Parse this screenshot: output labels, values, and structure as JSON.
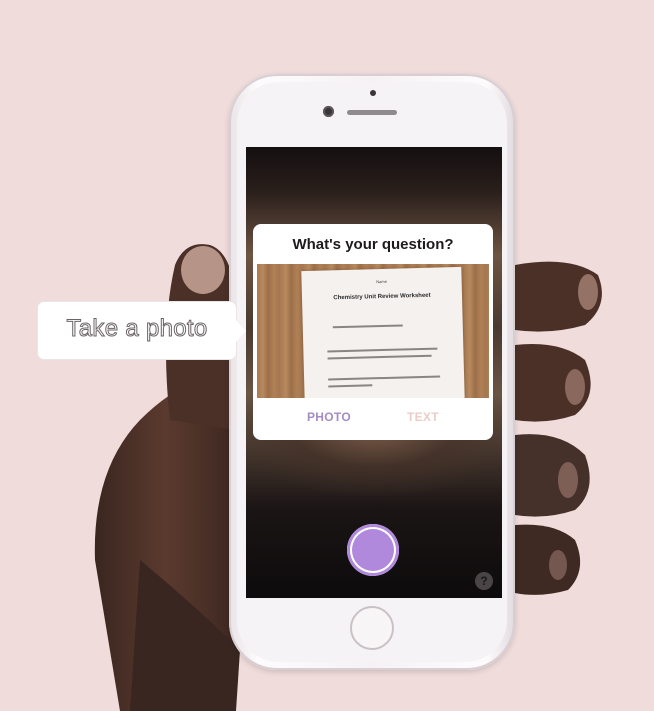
{
  "callout": {
    "text": "Take a photo"
  },
  "card": {
    "title": "What's your question?",
    "worksheet": {
      "small_text": "Name",
      "title": "Chemistry Unit Review Worksheet"
    },
    "tabs": [
      {
        "label": "PHOTO",
        "active": true
      },
      {
        "label": "TEXT",
        "active": false
      }
    ]
  },
  "help": {
    "label": "?"
  },
  "colors": {
    "background": "#f0dcdb",
    "accent_purple": "#b088dc",
    "tab_active": "#a58bc4",
    "tab_inactive": "#e9cdc8"
  },
  "icons": [
    "shutter-button",
    "help-icon",
    "home-button"
  ]
}
